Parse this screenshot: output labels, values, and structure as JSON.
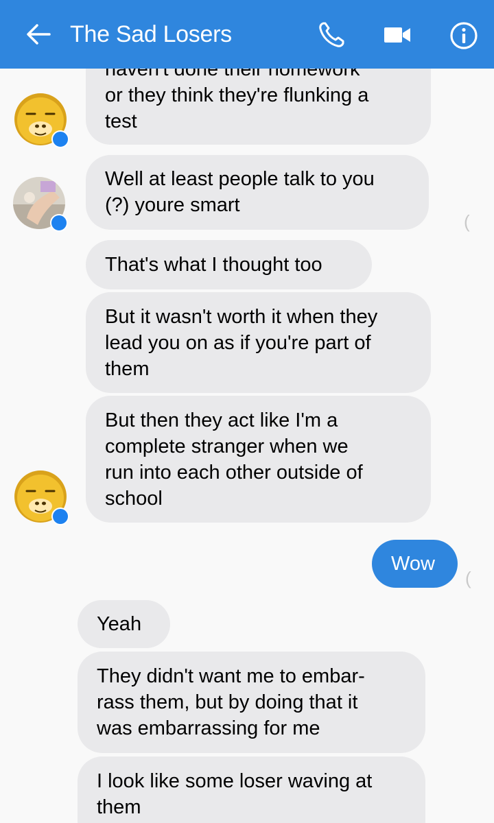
{
  "header": {
    "title": "The Sad Losers",
    "accent_color": "#2f86de",
    "icons": [
      "back-arrow-icon",
      "phone-icon",
      "video-camera-icon",
      "info-icon"
    ]
  },
  "messages": [
    {
      "sender": "other",
      "avatar": "yellow-bear",
      "text": "haven't done their homework\nor they think they're flunking a\ntest"
    },
    {
      "sender": "other",
      "avatar": "photo",
      "text": "Well at least people talk to you\n(?) youre smart"
    },
    {
      "sender": "other",
      "text": "That's what I thought too"
    },
    {
      "sender": "other",
      "text": "But it wasn't worth it when they\nlead you on as if you're part of\nthem"
    },
    {
      "sender": "other",
      "avatar": "yellow-bear",
      "text": "But then they act like I'm a\ncomplete stranger when we\nrun into each other outside of\nschool"
    },
    {
      "sender": "me",
      "text": "Wow"
    },
    {
      "sender": "other",
      "text": "Yeah"
    },
    {
      "sender": "other",
      "text": "They didn't want me to embar-\nrass them, but by doing that it\nwas embarrassing for me"
    },
    {
      "sender": "other",
      "text": "I look like some loser waving at\nthem"
    }
  ]
}
